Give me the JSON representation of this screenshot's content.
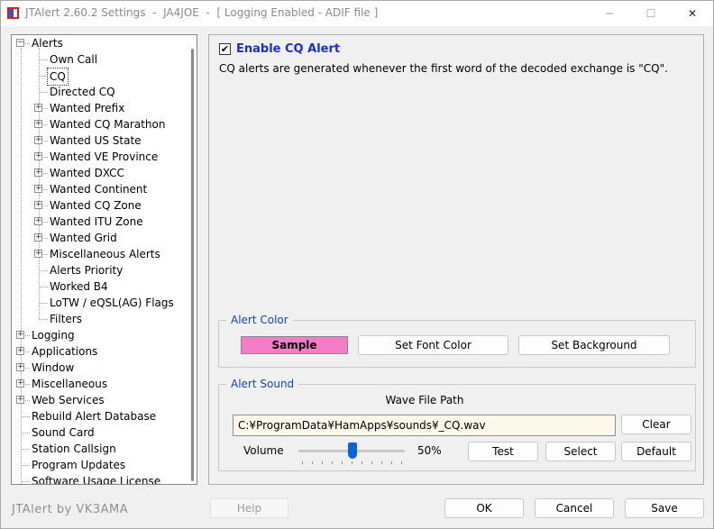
{
  "window": {
    "title": "JTAlert 2.60.2 Settings  -  JA4JOE  -  [ Logging Enabled - ADIF file ]",
    "icon": "jtalert-app-icon",
    "controls": {
      "minimize": "─",
      "maximize": "☐",
      "close": "✕"
    }
  },
  "tree": {
    "items": [
      {
        "label": "Alerts",
        "expander": "⊟"
      },
      {
        "label": "Own Call"
      },
      {
        "label": "CQ",
        "selected": true
      },
      {
        "label": "Directed CQ"
      },
      {
        "label": "Wanted Prefix",
        "expander": "⊞"
      },
      {
        "label": "Wanted CQ Marathon",
        "expander": "⊞"
      },
      {
        "label": "Wanted US State",
        "expander": "⊞"
      },
      {
        "label": "Wanted VE Province",
        "expander": "⊞"
      },
      {
        "label": "Wanted DXCC",
        "expander": "⊞"
      },
      {
        "label": "Wanted Continent",
        "expander": "⊞"
      },
      {
        "label": "Wanted CQ Zone",
        "expander": "⊞"
      },
      {
        "label": "Wanted ITU Zone",
        "expander": "⊞"
      },
      {
        "label": "Wanted Grid",
        "expander": "⊞"
      },
      {
        "label": "Miscellaneous Alerts",
        "expander": "⊞"
      },
      {
        "label": "Alerts Priority"
      },
      {
        "label": "Worked B4"
      },
      {
        "label": "LoTW / eQSL(AG) Flags"
      },
      {
        "label": "Filters"
      },
      {
        "label": "Logging",
        "expander": "⊞"
      },
      {
        "label": "Applications",
        "expander": "⊞"
      },
      {
        "label": "Window",
        "expander": "⊞"
      },
      {
        "label": "Miscellaneous",
        "expander": "⊞"
      },
      {
        "label": "Web Services",
        "expander": "⊞"
      },
      {
        "label": "Rebuild Alert Database"
      },
      {
        "label": "Sound Card"
      },
      {
        "label": "Station Callsign"
      },
      {
        "label": "Program Updates"
      },
      {
        "label": "Software Usage License"
      }
    ]
  },
  "panel": {
    "enable_checkbox": {
      "label": "Enable CQ Alert",
      "checked": true,
      "mark": "✔"
    },
    "description": "CQ alerts are generated whenever the first word of the decoded exchange is \"CQ\".",
    "alert_color": {
      "title": "Alert Color",
      "sample_label": "Sample",
      "sample_color": "#f47dc8",
      "set_font_color": "Set Font Color",
      "set_background": "Set Background"
    },
    "alert_sound": {
      "title": "Alert Sound",
      "wave_file_label": "Wave File Path",
      "wave_file_path": "C:¥ProgramData¥HamApps¥sounds¥_CQ.wav",
      "clear": "Clear",
      "volume_label": "Volume",
      "volume_value": 0.5,
      "volume_text": "50%",
      "test": "Test",
      "select": "Select",
      "default": "Default"
    }
  },
  "footer": {
    "brand": "JTAlert by VK3AMA",
    "help": "Help",
    "ok": "OK",
    "cancel": "Cancel",
    "save": "Save"
  },
  "colors": {
    "accent_blue": "#1a2ed0",
    "group_title_blue": "#1a44b8",
    "slider_blue": "#0a64d6",
    "path_background": "#fcf8ec"
  }
}
